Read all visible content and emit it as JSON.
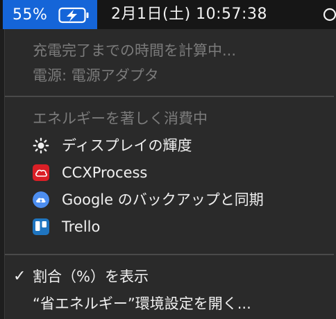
{
  "menubar": {
    "battery_percent": "55%",
    "clock": "2月1日(土)  10:57:38",
    "accent_color": "#1565d8"
  },
  "menu": {
    "time_remaining": "充電完了までの時間を計算中...",
    "power_source": "電源: 電源アダプタ",
    "energy_header": "エネルギーを著しく消費中",
    "apps": [
      {
        "label": "ディスプレイの輝度",
        "icon": "brightness-icon"
      },
      {
        "label": "CCXProcess",
        "icon": "creative-cloud-icon"
      },
      {
        "label": "Google のバックアップと同期",
        "icon": "google-backup-sync-icon"
      },
      {
        "label": "Trello",
        "icon": "trello-icon"
      }
    ],
    "show_percent": "割合（%）を表示",
    "show_percent_checked": true,
    "energy_saver": "“省エネルギー”環境設定を開く..."
  }
}
